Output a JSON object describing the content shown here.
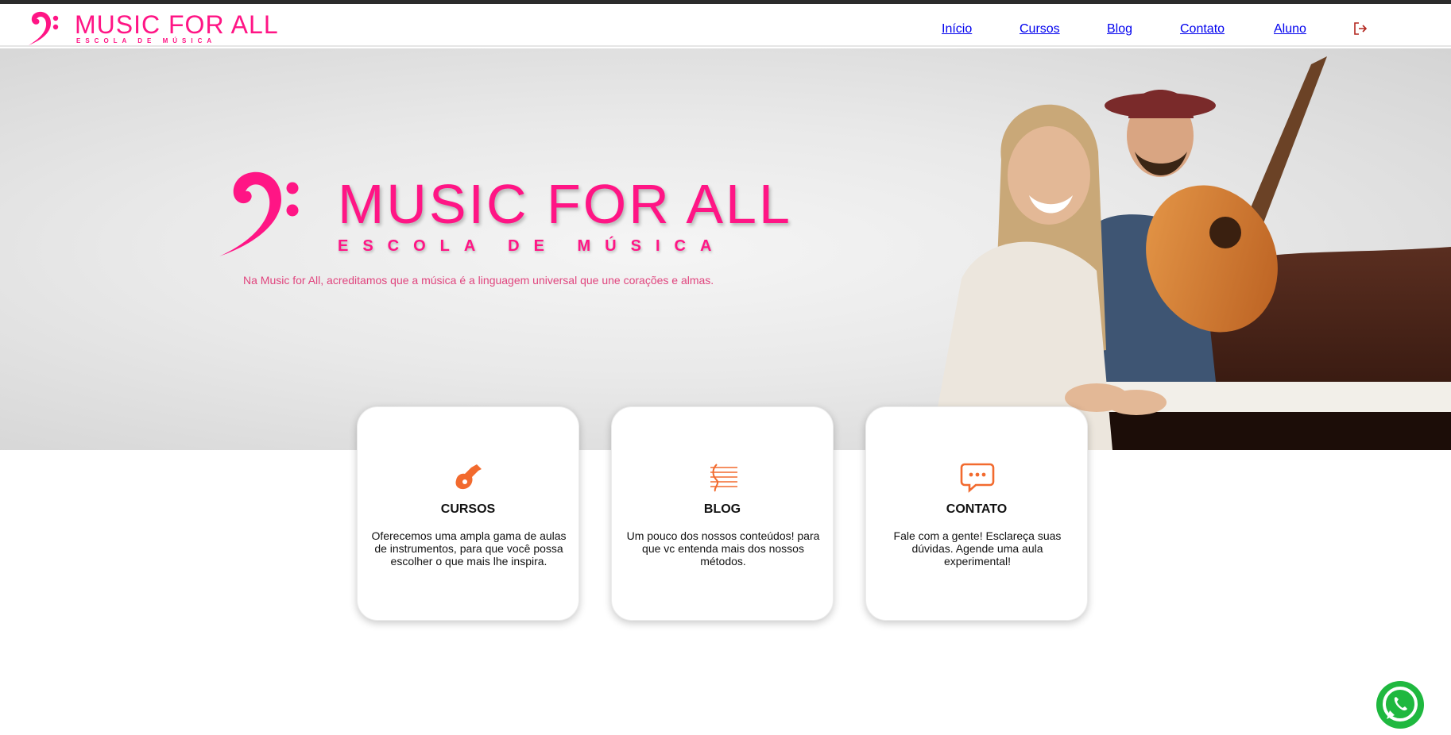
{
  "brand": {
    "name": "MUSIC FOR ALL",
    "tagline": "ESCOLA DE MÚSICA",
    "color": "#ff1585"
  },
  "nav": {
    "items": [
      {
        "label": "Início"
      },
      {
        "label": "Cursos"
      },
      {
        "label": "Blog"
      },
      {
        "label": "Contato"
      },
      {
        "label": "Aluno"
      }
    ],
    "logout_icon": "logout-icon"
  },
  "hero": {
    "brand_name": "MUSIC FOR ALL",
    "brand_tagline": "ESCOLA DE MÚSICA",
    "text": "Na Music for All, acreditamos que a música é a linguagem universal que une corações e almas."
  },
  "cards": [
    {
      "icon": "guitar-icon",
      "title": "CURSOS",
      "text": "Oferecemos uma ampla gama de aulas de instrumentos, para que você possa escolher o que mais lhe inspira."
    },
    {
      "icon": "music-staff-icon",
      "title": "BLOG",
      "text": "Um pouco dos nossos conteúdos! para que vc entenda mais dos nossos métodos."
    },
    {
      "icon": "chat-icon",
      "title": "CONTATO",
      "text": "Fale com a gente! Esclareça suas dúvidas. Agende uma aula experimental!"
    }
  ],
  "accent_color": "#f26a2e",
  "whatsapp_icon": "whatsapp-icon"
}
